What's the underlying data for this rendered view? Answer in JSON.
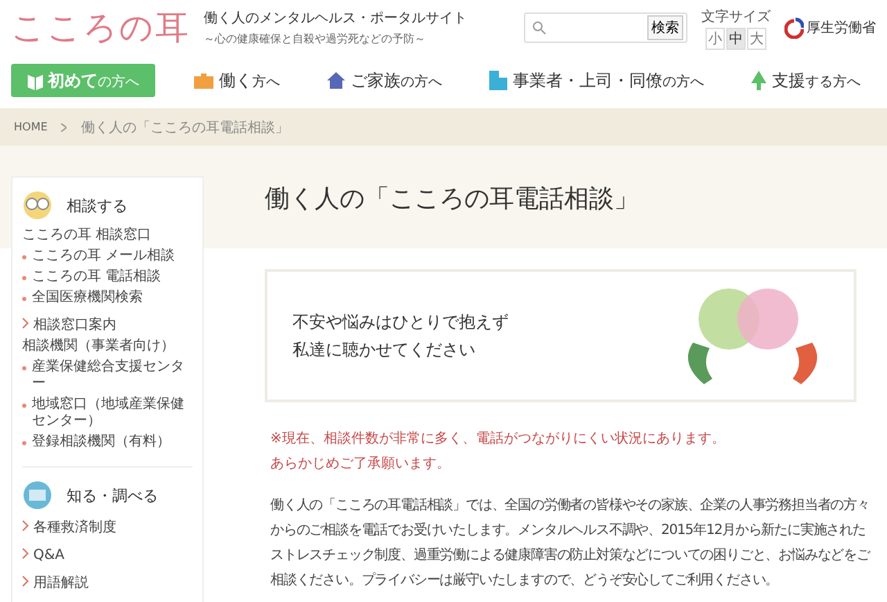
{
  "header": {
    "logo": "こころの耳",
    "tagline": "働く人のメンタルヘルス・ポータルサイト",
    "subtagline": "～心の健康確保と自殺や過労死などの予防～",
    "search": {
      "button": "検索"
    },
    "font_size": {
      "label": "文字サイズ",
      "options": [
        {
          "label": "小",
          "selected": false
        },
        {
          "label": "中",
          "selected": true
        },
        {
          "label": "大",
          "selected": false
        }
      ]
    },
    "ministry": "厚生労働省"
  },
  "nav": [
    {
      "kind": "first",
      "label": "初めて",
      "suffix": "の方へ"
    },
    {
      "kind": "work",
      "label": "働く",
      "suffix": "方へ"
    },
    {
      "kind": "family",
      "label": "ご家族",
      "suffix": "の方へ"
    },
    {
      "kind": "business",
      "label": "事業者・上司・同僚",
      "suffix": "の方へ"
    },
    {
      "kind": "support",
      "label": "支援",
      "suffix": "する方へ"
    }
  ],
  "breadcrumb": [
    {
      "label": "HOME"
    },
    {
      "label": "働く人の「こころの耳電話相談」"
    }
  ],
  "sidebar": [
    {
      "title": "相談する",
      "items": [
        {
          "kind": "heading",
          "text": "こころの耳 相談窓口"
        },
        {
          "kind": "bullet",
          "text": "こころの耳 メール相談"
        },
        {
          "kind": "bullet",
          "text": "こころの耳 電話相談"
        },
        {
          "kind": "bullet",
          "text": "全国医療機関検索"
        },
        {
          "kind": "arrow",
          "text": "相談窓口案内"
        },
        {
          "kind": "heading",
          "text": "相談機関（事業者向け）"
        },
        {
          "kind": "bullet",
          "text": "産業保健総合支援センター"
        },
        {
          "kind": "bullet",
          "text": "地域窓口（地域産業保健センター）"
        },
        {
          "kind": "bullet",
          "text": "登録相談機関（有料）"
        }
      ]
    },
    {
      "title": "知る・調べる",
      "items": [
        {
          "kind": "arrow",
          "text": "各種救済制度"
        },
        {
          "kind": "arrow",
          "text": "Q&A"
        },
        {
          "kind": "arrow",
          "text": "用語解説"
        }
      ]
    }
  ],
  "page_title": "働く人の「こころの耳電話相談」",
  "banner": {
    "lines": [
      "不安や悩みはひとりで抱えず",
      "私達に聴かせてください"
    ]
  },
  "notice": [
    "※現在、相談件数が非常に多く、電話がつながりにくい状況にあります。",
    "あらかじめご了承願います。"
  ],
  "body": "働く人の「こころの耳電話相談」では、全国の労働者の皆様やその家族、企業の人事労務担当者の方々からのご相談を電話でお受けいたします。メンタルヘルス不調や、2015年12月から新たに実施されたストレスチェック制度、過重労働による健康障害の防止対策などについての困りごと、お悩みなどをご相談ください。プライバシーは厳守いたしますので、どうぞ安心してご利用ください。"
}
